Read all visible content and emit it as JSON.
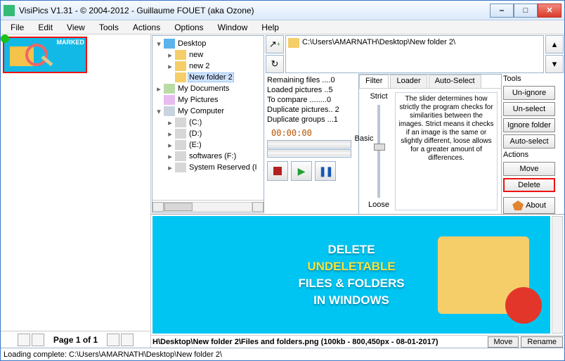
{
  "title": "VisiPics V1.31 - © 2004-2012 - Guillaume FOUET (aka Ozone)",
  "menu": [
    "File",
    "Edit",
    "View",
    "Tools",
    "Actions",
    "Options",
    "Window",
    "Help"
  ],
  "thumb_marked_label": "MARKED",
  "pager_label": "Page 1 of 1",
  "tree": {
    "items": [
      {
        "level": 0,
        "exp": "▾",
        "icon": "desktop",
        "label": "Desktop",
        "sel": false
      },
      {
        "level": 1,
        "exp": "▸",
        "icon": "folder",
        "label": "new",
        "sel": false
      },
      {
        "level": 1,
        "exp": "▸",
        "icon": "folder",
        "label": "new 2",
        "sel": false
      },
      {
        "level": 1,
        "exp": "",
        "icon": "folder",
        "label": "New folder 2",
        "sel": true
      },
      {
        "level": 0,
        "exp": "▸",
        "icon": "docs",
        "label": "My Documents",
        "sel": false
      },
      {
        "level": 0,
        "exp": "",
        "icon": "pics",
        "label": "My Pictures",
        "sel": false
      },
      {
        "level": 0,
        "exp": "▾",
        "icon": "pc",
        "label": "My Computer",
        "sel": false
      },
      {
        "level": 1,
        "exp": "▸",
        "icon": "drive",
        "label": "(C:)",
        "sel": false
      },
      {
        "level": 1,
        "exp": "▸",
        "icon": "drive",
        "label": "(D:)",
        "sel": false
      },
      {
        "level": 1,
        "exp": "▸",
        "icon": "drive",
        "label": "(E:)",
        "sel": false
      },
      {
        "level": 1,
        "exp": "▸",
        "icon": "drive",
        "label": "softwares (F:)",
        "sel": false
      },
      {
        "level": 1,
        "exp": "▸",
        "icon": "drive",
        "label": "System Reserved (I",
        "sel": false
      }
    ]
  },
  "path_text": "C:\\Users\\AMARNATH\\Desktop\\New folder 2\\",
  "stats": {
    "l1": "Remaining files ....0",
    "l2": "Loaded pictures ..5",
    "l3": "To compare ........0",
    "l4": "Duplicate pictures.. 2",
    "l5": "Duplicate groups ...1"
  },
  "timer": "00:00:00",
  "filter": {
    "tabs": [
      "Filter",
      "Loader",
      "Auto-Select"
    ],
    "active_tab": 0,
    "ticks": [
      "Strict",
      "Basic",
      "Loose"
    ],
    "desc": "The slider determines how strictly the program checks for similarities between the images. Strict means it checks if an image is the same or slightly different, loose allows for a greater amount of differences."
  },
  "tools": {
    "group1_label": "Tools",
    "buttons1": [
      "Un-ignore",
      "Un-select",
      "Ignore folder",
      "Auto-select"
    ],
    "group2_label": "Actions",
    "buttons2": [
      "Move",
      "Delete"
    ],
    "about": "About"
  },
  "preview": {
    "line1": "DELETE",
    "line2": "UNDELETABLE",
    "line3": "FILES & FOLDERS",
    "line4": "IN WINDOWS"
  },
  "file_info": {
    "text": "H\\Desktop\\New folder 2\\Files and folders.png  (100kb - 800,450px - 08-01-2017)",
    "move": "Move",
    "rename": "Rename"
  },
  "status": "Loading complete: C:\\Users\\AMARNATH\\Desktop\\New folder 2\\"
}
